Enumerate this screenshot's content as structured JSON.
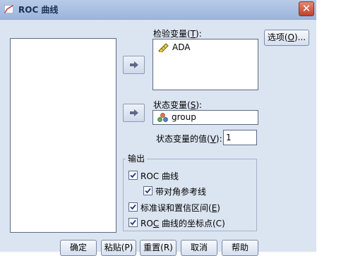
{
  "window": {
    "title": "ROC 曲线",
    "close_glyph": "✕"
  },
  "labels": {
    "test_var_prefix": "检验变量(",
    "test_var_key": "T",
    "test_var_suffix": "):",
    "state_var_prefix": "状态变量(",
    "state_var_key": "S",
    "state_var_suffix": "):",
    "state_value_prefix": "状态变量的值(",
    "state_value_key": "V",
    "state_value_suffix": "):"
  },
  "test_vars": [
    "ADA"
  ],
  "state_var": "group",
  "state_value": "1",
  "buttons": {
    "options_prefix": "选项(",
    "options_key": "O",
    "options_suffix": ")...",
    "ok": "确定",
    "paste": "粘贴(P)",
    "reset": "重置(R)",
    "cancel": "取消",
    "help": "帮助"
  },
  "output": {
    "group_title": "输出",
    "roc_curve": {
      "label": "ROC 曲线",
      "checked": true
    },
    "diagonal": {
      "label": "带对角参考线",
      "checked": true
    },
    "std_error_prefix": "标准误和置信区间(",
    "std_error_key": "E",
    "std_error_suffix": ")",
    "coords_pre": "RO",
    "coords_key": "C",
    "coords_post": " 曲线的坐标点(C)"
  },
  "icons": {
    "app": "roc-chart-icon",
    "ruler": "scale-variable-icon",
    "nominal": "nominal-variable-icon",
    "arrow": "move-right-arrow-icon"
  },
  "colors": {
    "dialog_bg": "#dbe4f1",
    "title_bar": "#9bb5dc",
    "close": "#c0402b"
  }
}
